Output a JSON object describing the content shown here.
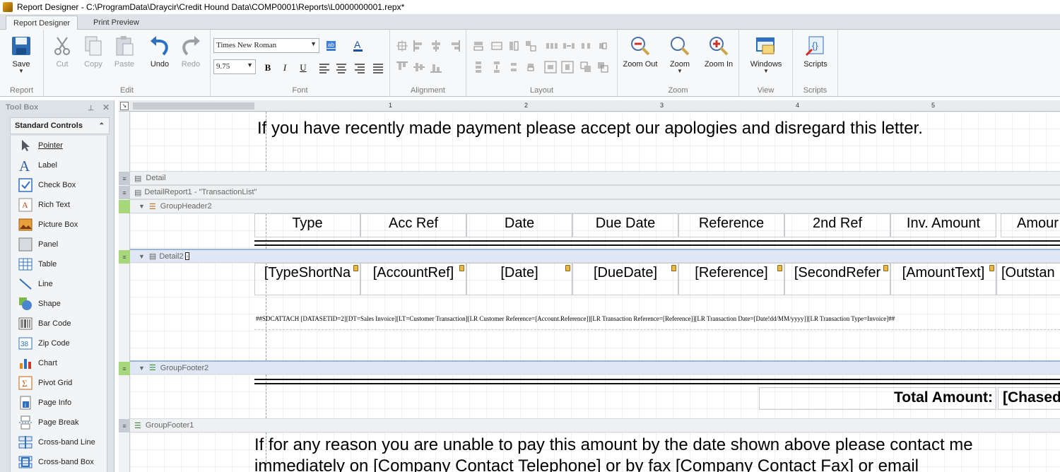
{
  "window": {
    "title": "Report Designer - C:\\ProgramData\\Draycir\\Credit Hound Data\\COMP0001\\Reports\\L0000000001.repx*"
  },
  "ribbon": {
    "tabs": [
      "Report Designer",
      "Print Preview"
    ],
    "report": {
      "save": "Save",
      "group": "Report"
    },
    "edit": {
      "cut": "Cut",
      "copy": "Copy",
      "paste": "Paste",
      "undo": "Undo",
      "redo": "Redo",
      "group": "Edit"
    },
    "font": {
      "family": "Times New Roman",
      "size": "9.75",
      "bold": "B",
      "italic": "I",
      "underline": "U",
      "group": "Font"
    },
    "alignment": {
      "group": "Alignment"
    },
    "layout": {
      "group": "Layout"
    },
    "zoom": {
      "zoom_out": "Zoom Out",
      "zoom": "Zoom",
      "zoom_in": "Zoom In",
      "group": "Zoom"
    },
    "view": {
      "windows": "Windows",
      "group": "View"
    },
    "scripts": {
      "scripts": "Scripts",
      "group": "Scripts"
    }
  },
  "toolbox": {
    "title": "Tool Box",
    "section": "Standard Controls",
    "items": [
      "Pointer",
      "Label",
      "Check Box",
      "Rich Text",
      "Picture Box",
      "Panel",
      "Table",
      "Line",
      "Shape",
      "Bar Code",
      "Zip Code",
      "Chart",
      "Pivot Grid",
      "Page Info",
      "Page Break",
      "Cross-band Line",
      "Cross-band Box"
    ]
  },
  "ruler": {
    "marks": [
      "1",
      "2",
      "3",
      "4",
      "5"
    ]
  },
  "report": {
    "apology_text": "If you have recently made payment please accept our apologies and disregard this letter.",
    "bands": {
      "detail": "Detail",
      "detail_report": "DetailReport1 - \"TransactionList\"",
      "group_header2": "GroupHeader2",
      "detail2": "Detail2",
      "group_footer2": "GroupFooter2",
      "group_footer1": "GroupFooter1"
    },
    "headers": [
      "Type",
      "Acc Ref",
      "Date",
      "Due Date",
      "Reference",
      "2nd Ref",
      "Inv. Amount",
      "Amour"
    ],
    "fields": [
      "[TypeShortNa",
      "[AccountRef]",
      "[Date]",
      "[DueDate]",
      "[Reference]",
      "[SecondRefer",
      "[AmountText]",
      "[Outstan"
    ],
    "attach_text": "##SDCATTACH [DATASETID=2][DT=Sales Invoice][LT=Customer Transaction][LR Customer Reference=[Account.Reference]][LR Transaction Reference=[Reference]][LR Transaction Date=[Date!dd/MM/yyyy]][LR Transaction Type=Invoice]##",
    "total_label": "Total Amount:",
    "total_value": "[Chased",
    "footer_line1": "If for any reason you are unable to pay this amount by the date shown above please contact me",
    "footer_line2": "immediately on [Company Contact Telephone] or by fax [Company Contact Fax] or email"
  }
}
